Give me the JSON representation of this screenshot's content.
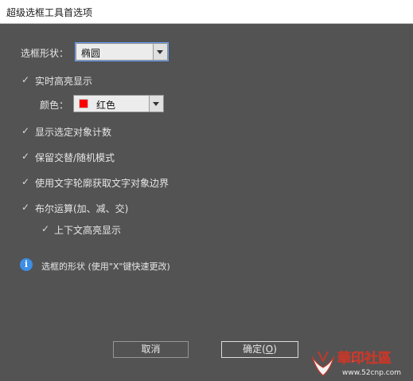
{
  "dialog": {
    "title": "超级选框工具首选项"
  },
  "shape": {
    "label": "选框形状：",
    "value": "椭圆"
  },
  "realtime_highlight": {
    "label": "实时高亮显示",
    "checked": true
  },
  "color": {
    "label": "颜色：",
    "value": "红色",
    "swatch": "#ff0000"
  },
  "options": [
    {
      "label": "显示选定对象计数",
      "checked": true
    },
    {
      "label": "保留交替/随机模式",
      "checked": true
    },
    {
      "label": "使用文字轮廓获取文字对象边界",
      "checked": true
    },
    {
      "label": "布尔运算(加、减、交)",
      "checked": true
    },
    {
      "label": "上下文高亮显示",
      "checked": true
    }
  ],
  "info": {
    "text": "选框的形状 (使用\"X\"键快速更改)"
  },
  "buttons": {
    "cancel": "取消",
    "ok_prefix": "确定(",
    "ok_key": "O",
    "ok_suffix": ")"
  },
  "watermark": {
    "brand": "華印社區",
    "url": "www.52cnp.com"
  },
  "colors": {
    "background": "#535353",
    "info_icon": "#3c8ee6"
  }
}
